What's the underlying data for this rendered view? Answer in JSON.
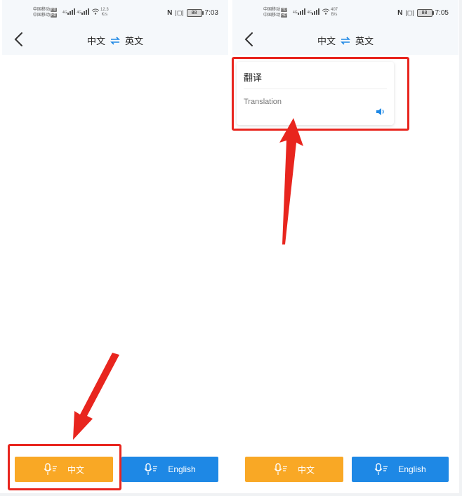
{
  "left_screen": {
    "status": {
      "carrier_line1": "中国移动",
      "carrier_line2": "中国移动",
      "hd_badge": "HD",
      "net_label": "4G",
      "speed_value": "12.3",
      "speed_unit": "K/s",
      "battery": "88",
      "time": "7:03"
    },
    "nav": {
      "source_lang": "中文",
      "target_lang": "英文"
    },
    "buttons": {
      "chinese_label": "中文",
      "english_label": "English"
    }
  },
  "right_screen": {
    "status": {
      "carrier_line1": "中国移动",
      "carrier_line2": "中国移动",
      "hd_badge": "HD",
      "net_label": "4G",
      "speed_value": "407",
      "speed_unit": "B/s",
      "battery": "88",
      "time": "7:05"
    },
    "nav": {
      "source_lang": "中文",
      "target_lang": "英文"
    },
    "card": {
      "source_text": "翻译",
      "translated_text": "Translation"
    },
    "buttons": {
      "chinese_label": "中文",
      "english_label": "English"
    }
  },
  "colors": {
    "chinese_button": "#f9a825",
    "english_button": "#1e88e5",
    "annotation_red": "#e8251e",
    "topbar_bg": "#f5f8fb"
  },
  "icons": [
    "back-arrow-icon",
    "swap-arrows-icon",
    "microphone-icon",
    "speaker-icon",
    "wifi-icon",
    "signal-icon",
    "nfc-icon",
    "vibrate-icon",
    "battery-icon"
  ]
}
